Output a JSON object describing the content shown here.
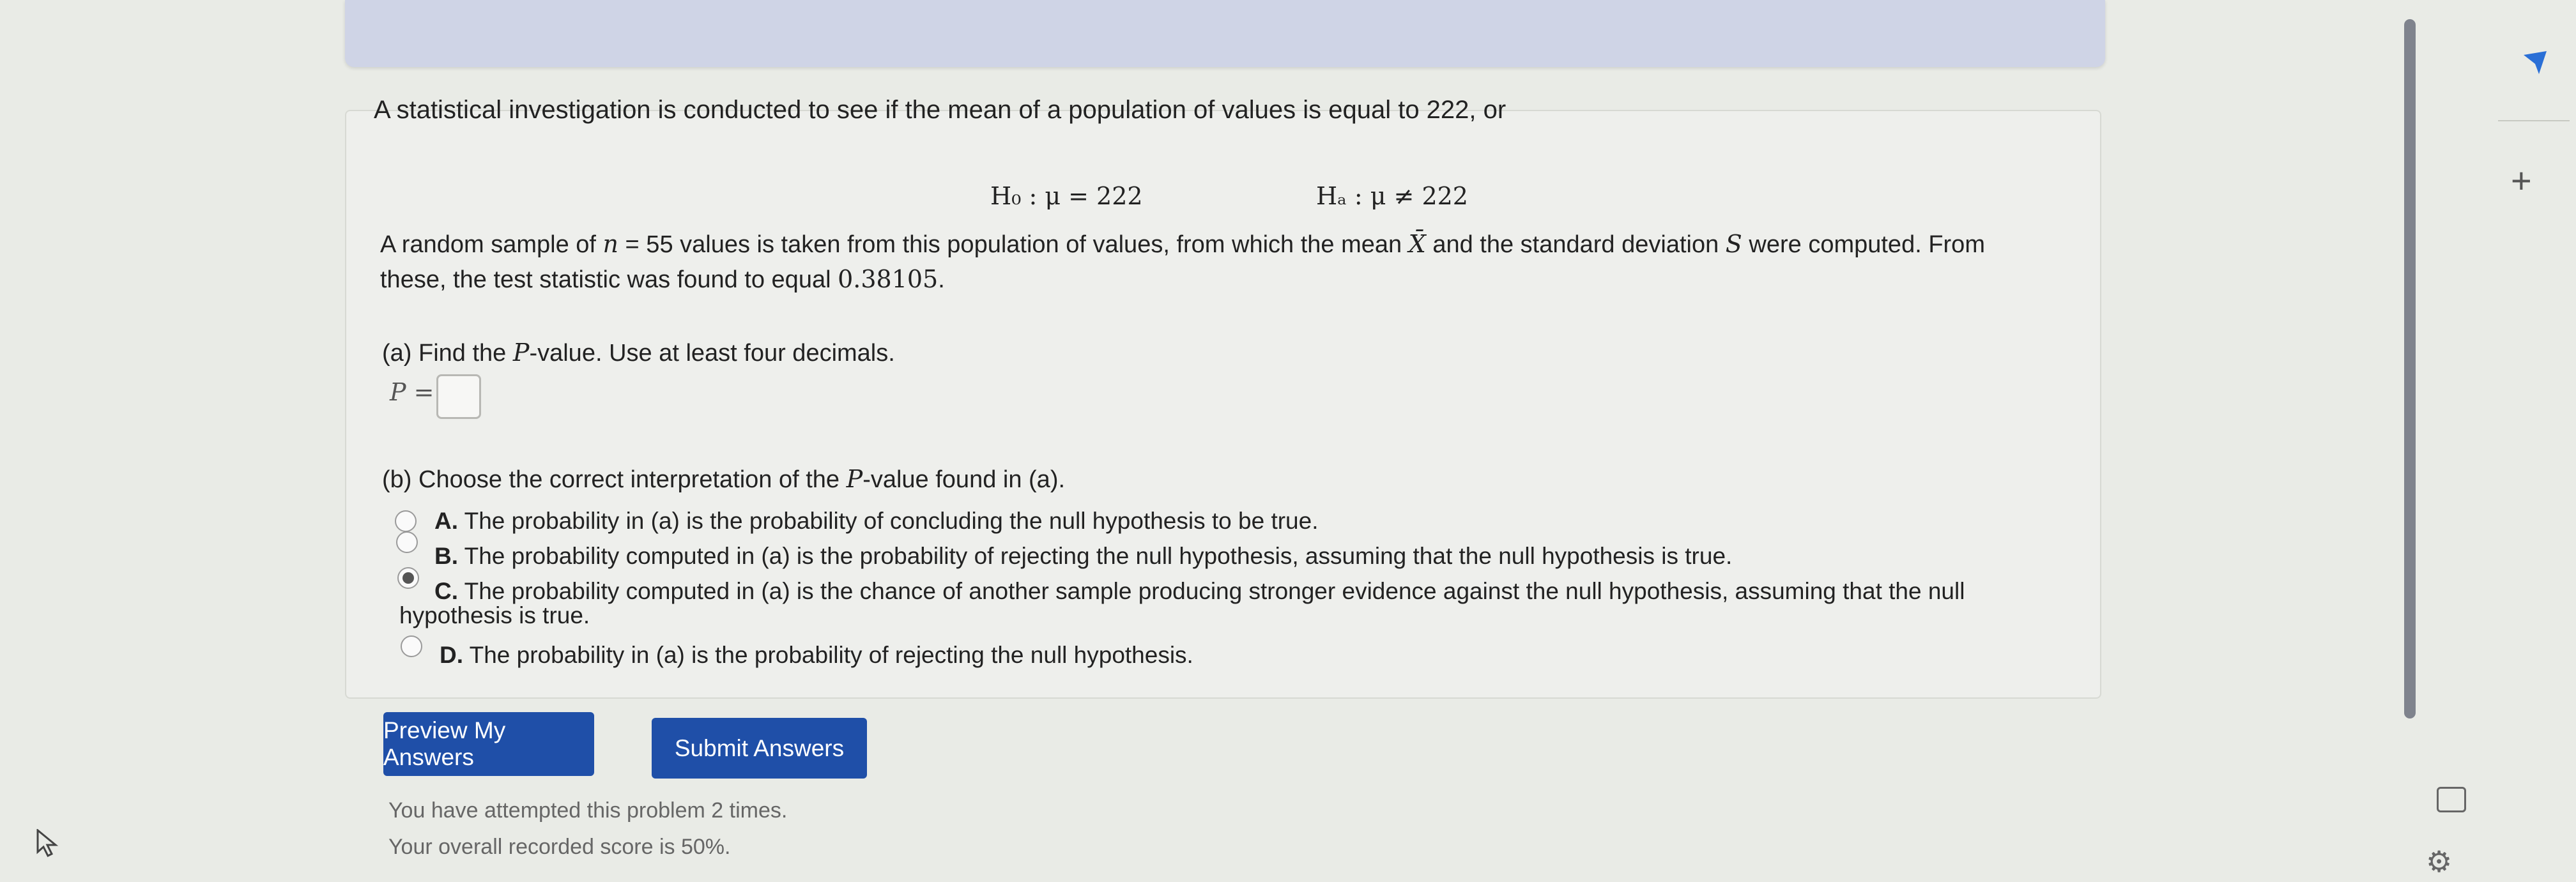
{
  "problem": {
    "statement": "A statistical investigation is conducted to see if the mean of a population of values is equal to 222, or",
    "h0": "H₀ : μ = 222",
    "ha": "Hₐ : μ ≠ 222",
    "sample_part1": "A random sample of ",
    "n_var": "n",
    "sample_part2": " = 55 values is taken from this population of values, from which the mean ",
    "xbar": "X̄",
    "sample_part3": " and the standard deviation ",
    "s_var": "S",
    "sample_part4": " were computed. From these, the test statistic was found to equal ",
    "test_stat": "0.38105",
    "sample_end": "."
  },
  "part_a": {
    "prompt_start": "(a) Find the ",
    "p_var": "P",
    "prompt_end": "-value. Use at least four decimals.",
    "p_label": "P =",
    "answer_value": ""
  },
  "part_b": {
    "prompt_start": "(b) Choose the correct interpretation of the ",
    "p_var": "P",
    "prompt_end": "-value found in (a).",
    "options": [
      {
        "letter": "A.",
        "text": " The probability in (a) is the probability of concluding the null hypothesis to be true.",
        "selected": false
      },
      {
        "letter": "B.",
        "text": " The probability computed in (a) is the probability of rejecting the null hypothesis, assuming that the null hypothesis is true.",
        "selected": false
      },
      {
        "letter": "C.",
        "text": " The probability computed in (a) is the chance of another sample producing stronger evidence against the null hypothesis, assuming that the null",
        "text_cont": "hypothesis is true.",
        "selected": true
      },
      {
        "letter": "D.",
        "text": " The probability in (a) is the probability of rejecting the null hypothesis.",
        "selected": false
      }
    ]
  },
  "buttons": {
    "preview": "Preview My Answers",
    "submit": "Submit Answers"
  },
  "status": {
    "attempts": "You have attempted this problem 2 times.",
    "score": "Your overall recorded score is 50%."
  },
  "sidebar": {
    "plus": "+"
  },
  "colors": {
    "button": "#1f4fa8",
    "background": "#e9ebe6"
  },
  "icons": [
    "arrow-icon",
    "plus-icon",
    "panel-icon",
    "gear-icon",
    "cursor-icon"
  ]
}
